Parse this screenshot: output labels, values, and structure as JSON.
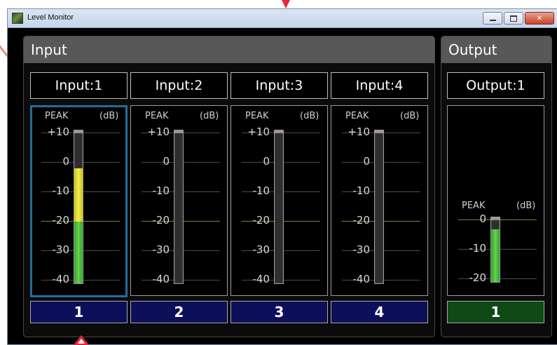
{
  "window": {
    "title": "Level Monitor"
  },
  "colors": {
    "input_button": "#0d0f5a",
    "output_button": "#0f4a16",
    "selected_border": "#1f6f9a",
    "peak_green": "#49c23a",
    "peak_yellow": "#eae63e",
    "annotation": "#e8253a"
  },
  "input_panel": {
    "title": "Input",
    "channels": [
      {
        "label": "Input:1",
        "peak": "PEAK",
        "unit": "(dB)",
        "button": "1",
        "selected": true,
        "level_green_top_db": -20,
        "level_yellow_top_db": -2
      },
      {
        "label": "Input:2",
        "peak": "PEAK",
        "unit": "(dB)",
        "button": "2",
        "selected": false
      },
      {
        "label": "Input:3",
        "peak": "PEAK",
        "unit": "(dB)",
        "button": "3",
        "selected": false
      },
      {
        "label": "Input:4",
        "peak": "PEAK",
        "unit": "(dB)",
        "button": "4",
        "selected": false
      }
    ],
    "scale": [
      "+10",
      "0",
      "-10",
      "-20",
      "-30",
      "-40"
    ]
  },
  "output_panel": {
    "title": "Output",
    "channels": [
      {
        "label": "Output:1",
        "peak": "PEAK",
        "unit": "(dB)",
        "button": "1",
        "level_top_db": -3
      }
    ],
    "scale": [
      "0",
      "-10",
      "-20"
    ]
  }
}
